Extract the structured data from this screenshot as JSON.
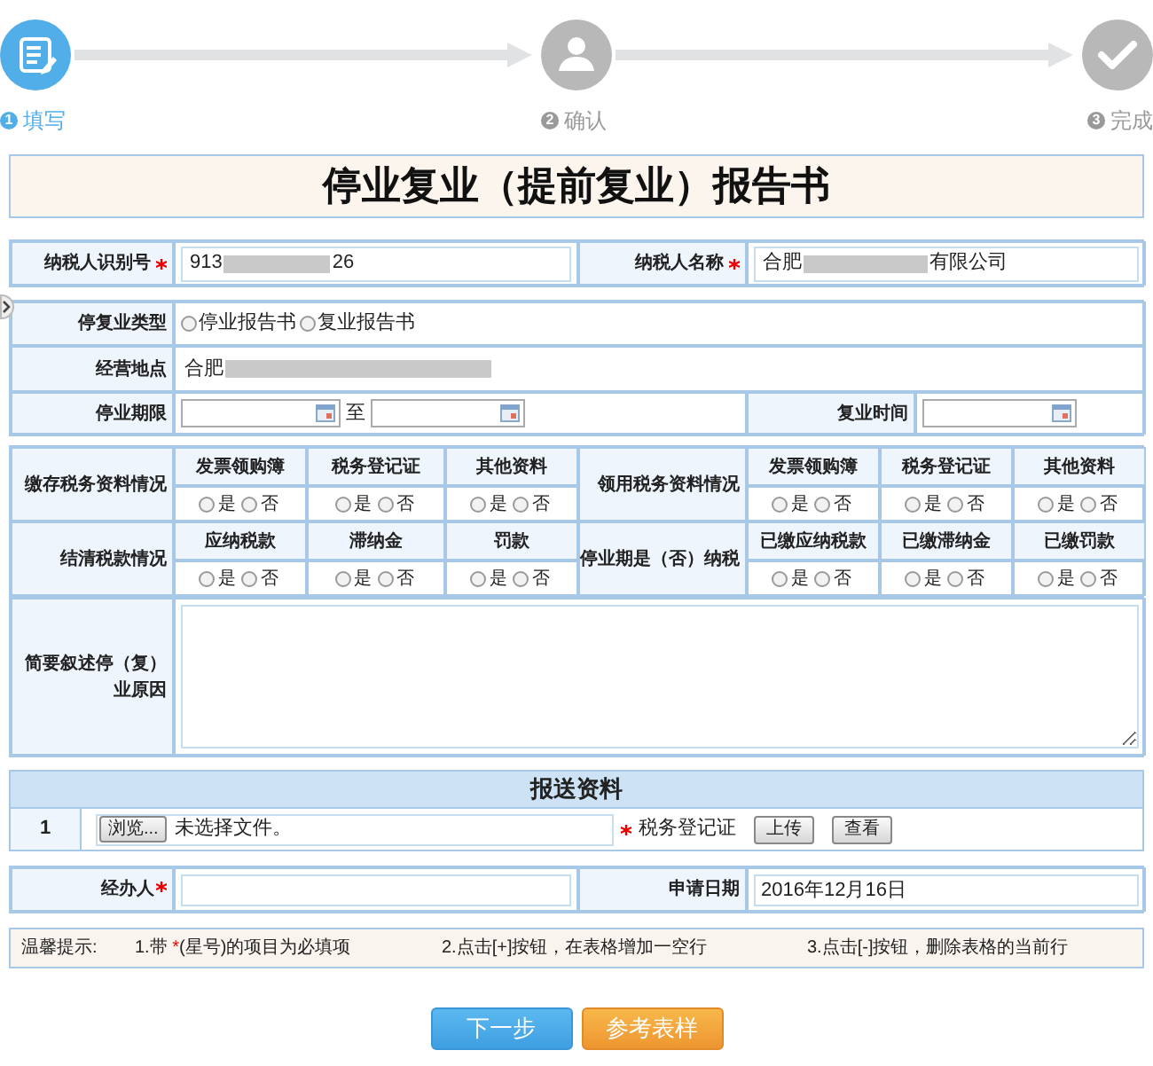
{
  "steps": [
    {
      "kind": "form",
      "number": "1",
      "label": "填写",
      "selected": true
    },
    {
      "kind": "user",
      "number": "2",
      "label": "确认",
      "selected": false
    },
    {
      "kind": "check",
      "number": "3",
      "label": "完成",
      "selected": false
    }
  ],
  "title": "停业复业（提前复业）报告书",
  "taxpayer": {
    "id_label": "纳税人识别号",
    "id_prefix": "913",
    "id_suffix": "26",
    "name_label": "纳税人名称",
    "name_prefix": "合肥",
    "name_suffix": "有限公司"
  },
  "type_row": {
    "label": "停复业类型",
    "options": [
      {
        "label": "停业报告书",
        "checked": false
      },
      {
        "label": "复业报告书",
        "checked": false
      }
    ]
  },
  "address_row": {
    "label": "经营地点",
    "value_prefix": "合肥"
  },
  "period_row": {
    "label": "停业期限",
    "separator": "至",
    "resume_label": "复业时间"
  },
  "materials": [
    {
      "label": "缴存税务资料情况",
      "items": [
        {
          "label": "发票领购簿",
          "options": [
            {
              "label": "是",
              "checked": false
            },
            {
              "label": "否",
              "checked": false
            }
          ]
        },
        {
          "label": "税务登记证",
          "options": [
            {
              "label": "是",
              "checked": false
            },
            {
              "label": "否",
              "checked": false
            }
          ]
        },
        {
          "label": "其他资料",
          "options": [
            {
              "label": "是",
              "checked": false
            },
            {
              "label": "否",
              "checked": false
            }
          ]
        }
      ]
    },
    {
      "label": "领用税务资料情况",
      "items": [
        {
          "label": "发票领购簿",
          "options": [
            {
              "label": "是",
              "checked": false
            },
            {
              "label": "否",
              "checked": false
            }
          ]
        },
        {
          "label": "税务登记证",
          "options": [
            {
              "label": "是",
              "checked": false
            },
            {
              "label": "否",
              "checked": false
            }
          ]
        },
        {
          "label": "其他资料",
          "options": [
            {
              "label": "是",
              "checked": false
            },
            {
              "label": "否",
              "checked": false
            }
          ]
        }
      ]
    },
    {
      "label": "结清税款情况",
      "items": [
        {
          "label": "应纳税款",
          "options": [
            {
              "label": "是",
              "checked": false
            },
            {
              "label": "否",
              "checked": false
            }
          ]
        },
        {
          "label": "滞纳金",
          "options": [
            {
              "label": "是",
              "checked": false
            },
            {
              "label": "否",
              "checked": false
            }
          ]
        },
        {
          "label": "罚款",
          "options": [
            {
              "label": "是",
              "checked": false
            },
            {
              "label": "否",
              "checked": false
            }
          ]
        }
      ]
    },
    {
      "label": "停业期是（否）纳税",
      "items": [
        {
          "label": "已缴应纳税款",
          "options": [
            {
              "label": "是",
              "checked": false
            },
            {
              "label": "否",
              "checked": false
            }
          ]
        },
        {
          "label": "已缴滞纳金",
          "options": [
            {
              "label": "是",
              "checked": false
            },
            {
              "label": "否",
              "checked": false
            }
          ]
        },
        {
          "label": "已缴罚款",
          "options": [
            {
              "label": "是",
              "checked": false
            },
            {
              "label": "否",
              "checked": false
            }
          ]
        }
      ]
    }
  ],
  "reason_label": "简要叙述停（复）业原因",
  "upload": {
    "heading": "报送资料",
    "rows": [
      {
        "index": "1",
        "browse": "浏览...",
        "file": "未选择文件。",
        "doc": "税务登记证",
        "upload": "上传",
        "view": "查看"
      }
    ]
  },
  "agent": {
    "label": "经办人",
    "date_label": "申请日期",
    "date": "2016年12月16日"
  },
  "tips": {
    "label": "温馨提示:",
    "items": [
      {
        "before": "1.带 ",
        "mark": "*",
        "after": "(星号)的项目为必填项"
      },
      {
        "before": "2.点击[+]按钮，在表格增加一空行"
      },
      {
        "before": "3.点击[-]按钮，删除表格的当前行"
      }
    ]
  },
  "buttons": [
    {
      "kind": "primary",
      "label": "下一步"
    },
    {
      "kind": "secondary",
      "label": "参考表样"
    }
  ]
}
